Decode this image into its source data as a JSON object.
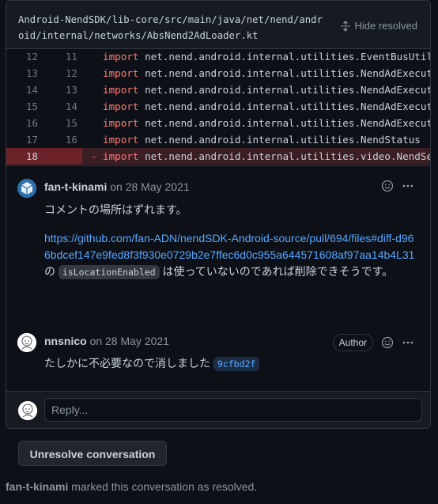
{
  "file": {
    "path": "Android-NendSDK/lib-core/src/main/java/net/nend/android/internal/networks/AbsNend2AdLoader.kt",
    "hide_resolved_label": "Hide resolved"
  },
  "code_lines": [
    {
      "old": "12",
      "new": "11",
      "sign": "",
      "keyword": "import",
      "text": " net.nend.android.internal.utilities.EventBusUtil",
      "deleted": false
    },
    {
      "old": "13",
      "new": "12",
      "sign": "",
      "keyword": "import",
      "text": " net.nend.android.internal.utilities.NendAdExecutor",
      "deleted": false
    },
    {
      "old": "14",
      "new": "13",
      "sign": "",
      "keyword": "import",
      "text": " net.nend.android.internal.utilities.NendAdExecutor",
      "deleted": false
    },
    {
      "old": "15",
      "new": "14",
      "sign": "",
      "keyword": "import",
      "text": " net.nend.android.internal.utilities.NendAdExecutor",
      "deleted": false
    },
    {
      "old": "16",
      "new": "15",
      "sign": "",
      "keyword": "import",
      "text": " net.nend.android.internal.utilities.NendAdExecutor",
      "deleted": false
    },
    {
      "old": "17",
      "new": "16",
      "sign": "",
      "keyword": "import",
      "text": " net.nend.android.internal.utilities.NendStatus",
      "deleted": false
    },
    {
      "old": "18",
      "new": "",
      "sign": "-",
      "keyword": "import",
      "text": " net.nend.android.internal.utilities.video.NendSense",
      "deleted": true
    }
  ],
  "comments": [
    {
      "author": "fan-t-kinami",
      "date": "on 28 May 2021",
      "line1": "コメントの場所はずれます。",
      "link": "https://github.com/fan-ADN/nendSDK-Android-source/pull/694/files#diff-d966bdcef147e9fed8f3f930e0729b2e7ffec6d0c955a644571608af97aa14b4L31",
      "line2_prefix": "の",
      "line2_code": "isLocationEnabled",
      "line2_suffix": "は使っていないのであれば削除できそうです。"
    },
    {
      "author": "nnsnico",
      "date": "on 28 May 2021",
      "badge": "Author",
      "text": "たしかに不必要なので消しました",
      "commit": "9cfbd2f"
    }
  ],
  "reply": {
    "placeholder": "Reply..."
  },
  "unresolve_label": "Unresolve conversation",
  "status": {
    "actor": "fan-t-kinami",
    "text": "marked this conversation as resolved."
  }
}
